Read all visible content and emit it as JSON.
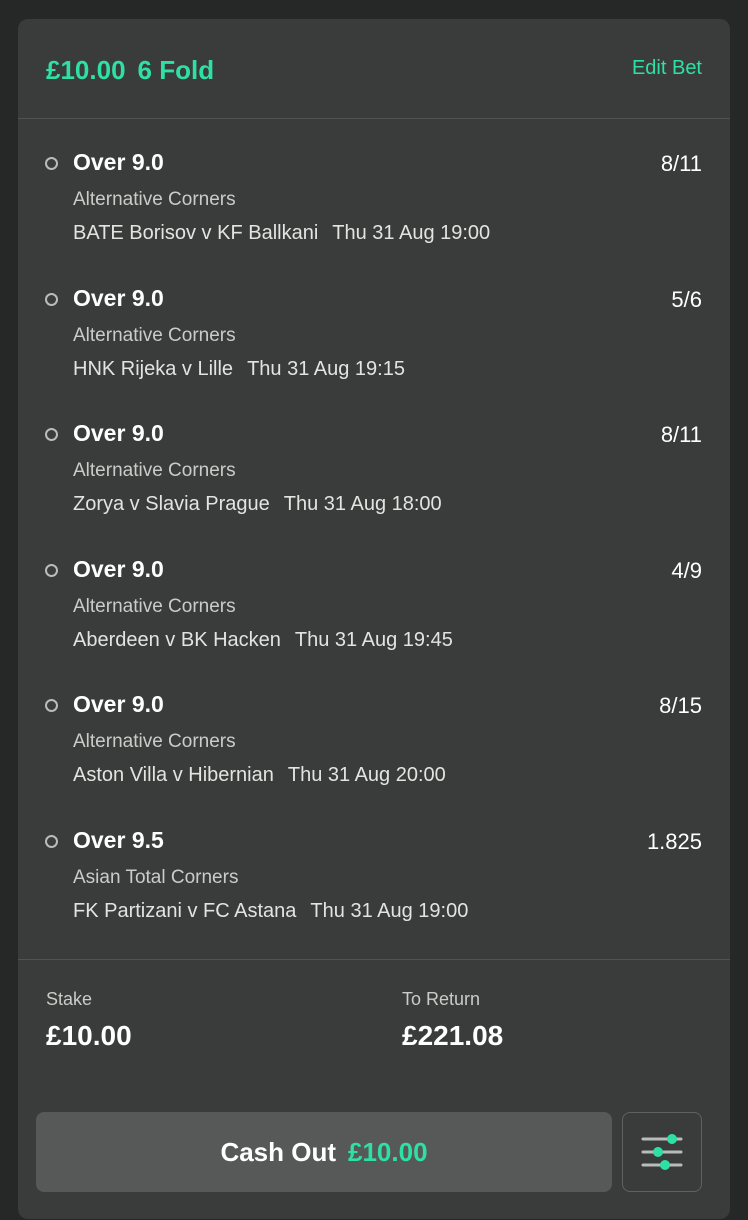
{
  "header": {
    "stake": "£10.00",
    "bet_type": "6 Fold",
    "edit_label": "Edit Bet"
  },
  "selections": [
    {
      "name": "Over 9.0",
      "odds": "8/11",
      "market": "Alternative Corners",
      "event": "BATE Borisov v KF Ballkani",
      "time": "Thu 31 Aug 19:00"
    },
    {
      "name": "Over 9.0",
      "odds": "5/6",
      "market": "Alternative Corners",
      "event": "HNK Rijeka v Lille",
      "time": "Thu 31 Aug 19:15"
    },
    {
      "name": "Over 9.0",
      "odds": "8/11",
      "market": "Alternative Corners",
      "event": "Zorya v Slavia Prague",
      "time": "Thu 31 Aug 18:00"
    },
    {
      "name": "Over 9.0",
      "odds": "4/9",
      "market": "Alternative Corners",
      "event": "Aberdeen v BK Hacken",
      "time": "Thu 31 Aug 19:45"
    },
    {
      "name": "Over 9.0",
      "odds": "8/15",
      "market": "Alternative Corners",
      "event": "Aston Villa v Hibernian",
      "time": "Thu 31 Aug 20:00"
    },
    {
      "name": "Over 9.5",
      "odds": "1.825",
      "market": "Asian Total Corners",
      "event": "FK Partizani v FC Astana",
      "time": "Thu 31 Aug 19:00"
    }
  ],
  "summary": {
    "stake_label": "Stake",
    "stake_value": "£10.00",
    "return_label": "To Return",
    "return_value": "£221.08"
  },
  "cashout": {
    "label": "Cash Out",
    "amount": "£10.00"
  },
  "icons": {
    "settings": "sliders-icon",
    "selection_status": "circle-outline-icon"
  },
  "colors": {
    "accent": "#2fe0a4",
    "card": "#393c3a",
    "background": "#262827"
  }
}
